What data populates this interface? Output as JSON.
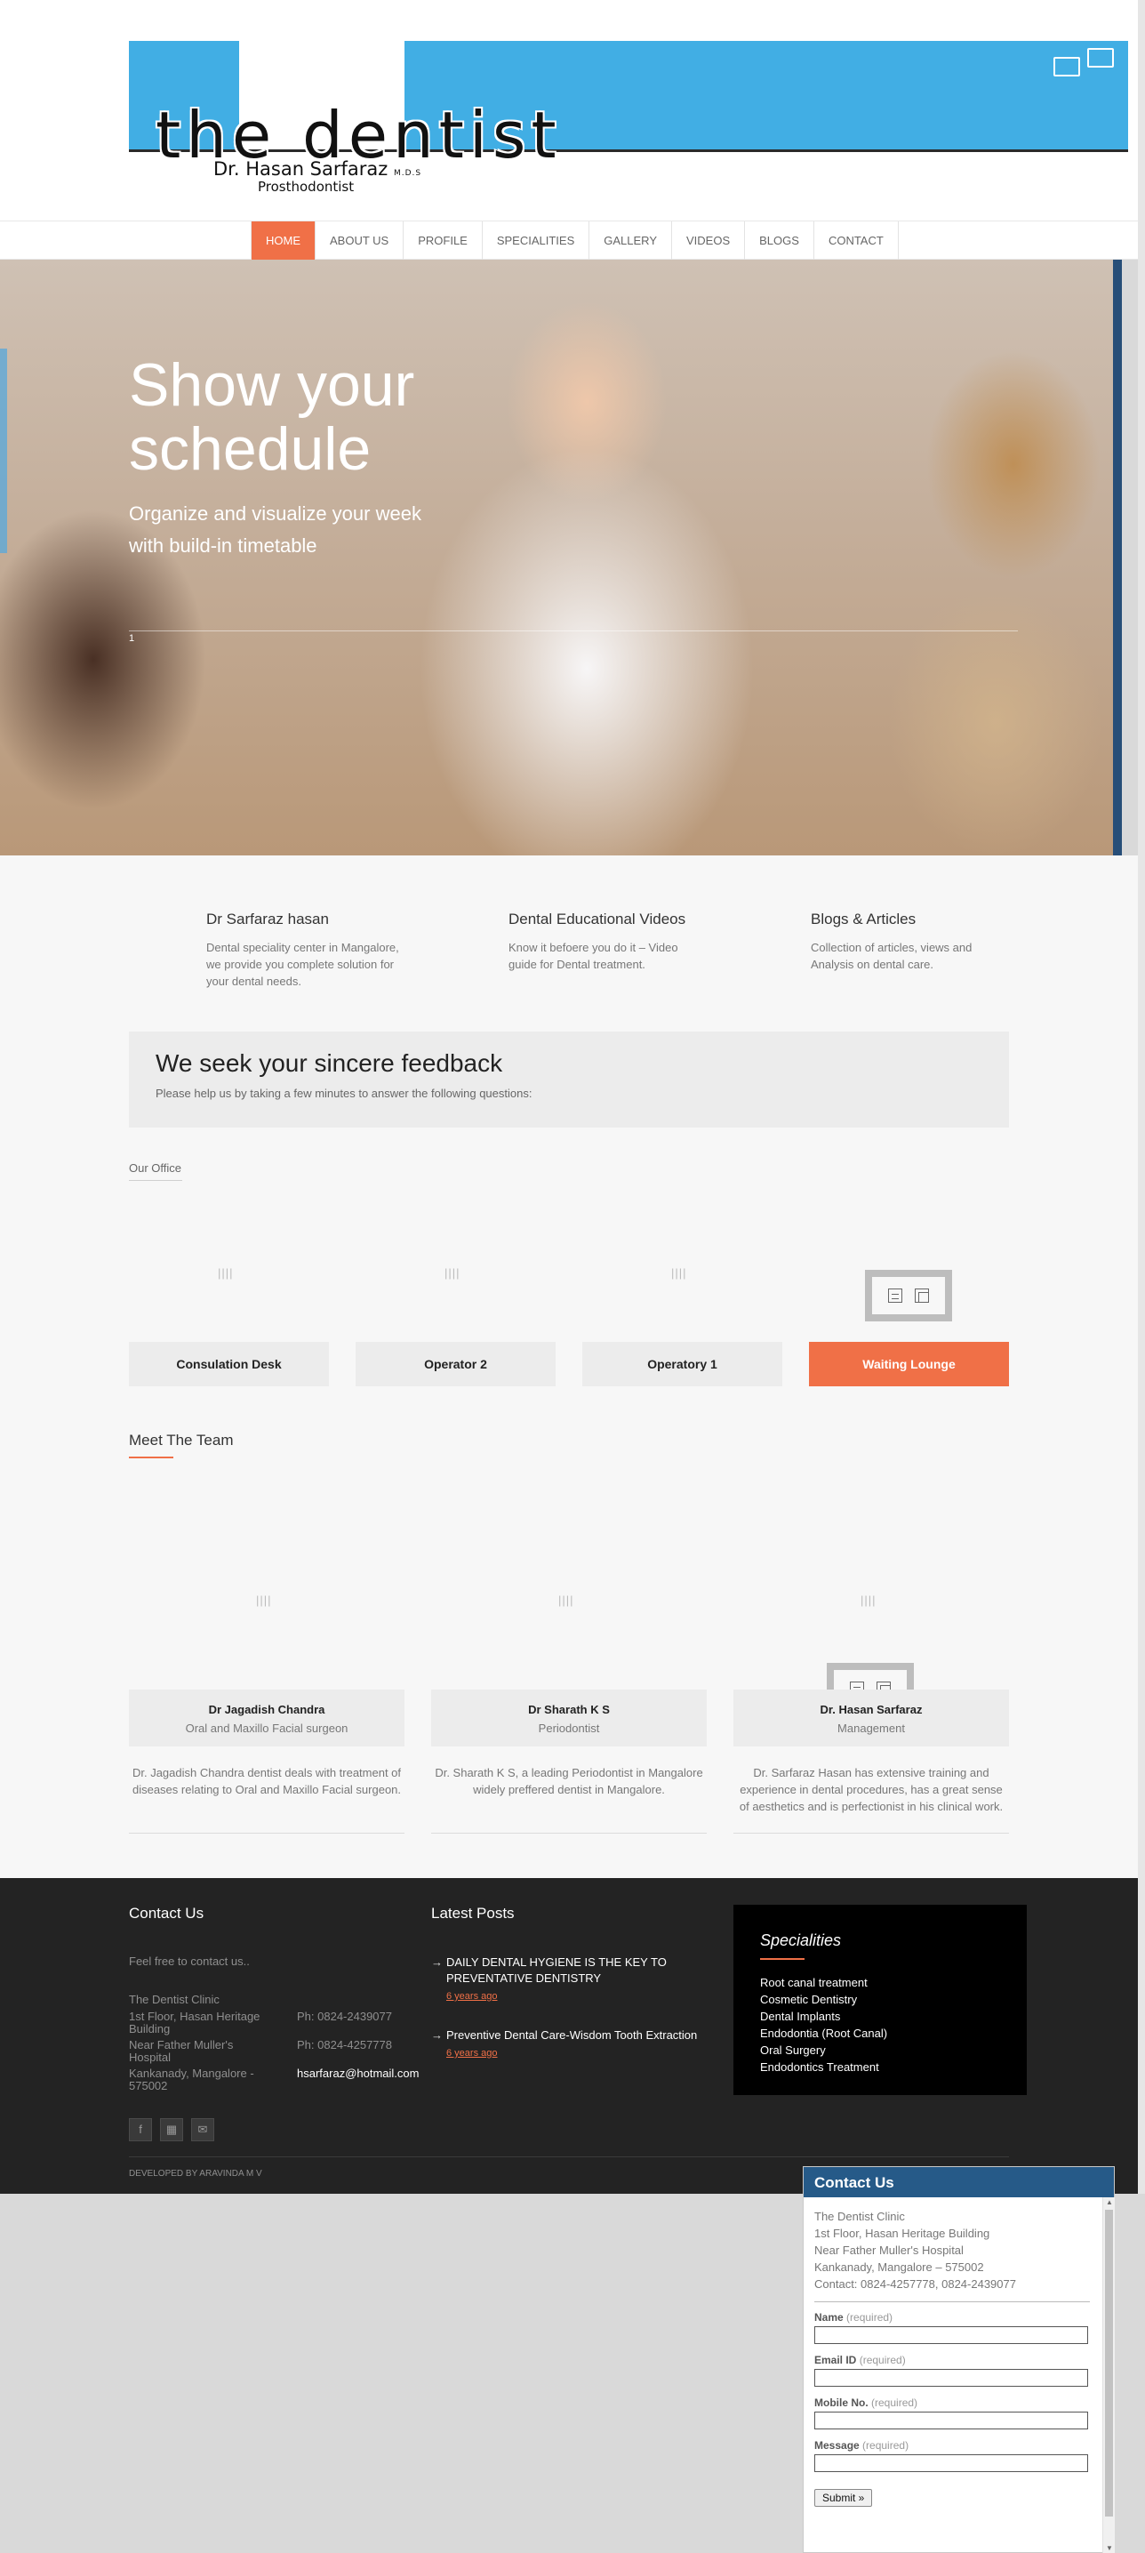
{
  "header": {
    "logo_title": "the dentist",
    "logo_doctor": "Dr. Hasan Sarfaraz",
    "logo_degree": "M.D.S",
    "logo_subtitle": "Prosthodontist",
    "brand_color": "#41aee4"
  },
  "nav": {
    "items": [
      "HOME",
      "ABOUT US",
      "PROFILE",
      "SPECIALITIES",
      "GALLERY",
      "VIDEOS",
      "BLOGS",
      "CONTACT"
    ],
    "active": "HOME",
    "accent_color": "#f07047"
  },
  "hero": {
    "title": "Show your schedule",
    "subtitle": "Organize and visualize your week with build-in timetable",
    "slide_number": "1"
  },
  "features": [
    {
      "title": "Dr Sarfaraz hasan",
      "text": "Dental speciality center in Mangalore, we provide you complete solution for your dental needs."
    },
    {
      "title": "Dental Educational Videos",
      "text": "Know it befoere you do it – Video guide for Dental treatment."
    },
    {
      "title": "Blogs & Articles",
      "text": "Collection of articles, views and Analysis on dental care."
    }
  ],
  "feedback": {
    "title": "We seek your sincere feedback",
    "text": "Please help us by taking a few minutes to answer the following questions:"
  },
  "office": {
    "label": "Our Office",
    "loader": "||||",
    "rooms": [
      "Consulation Desk",
      "Operator 2",
      "Operatory 1",
      "Waiting Lounge"
    ],
    "active_room": "Waiting Lounge"
  },
  "team": {
    "title": "Meet The Team",
    "members": [
      {
        "name": "Dr Jagadish Chandra",
        "role": "Oral and Maxillo Facial surgeon",
        "desc": "Dr. Jagadish Chandra dentist deals with treatment of diseases relating to Oral and Maxillo Facial surgeon."
      },
      {
        "name": "Dr Sharath K S",
        "role": "Periodontist",
        "desc": "Dr. Sharath K S, a leading Periodontist in Mangalore widely preffered dentist in Mangalore."
      },
      {
        "name": "Dr. Hasan Sarfaraz",
        "role": "Management",
        "desc": "Dr. Sarfaraz Hasan has extensive training and experience in dental procedures, has a great sense of aesthetics and is perfectionist in his clinical work."
      }
    ]
  },
  "footer": {
    "contact_title": "Contact Us",
    "contact_intro": "Feel free to contact us..",
    "clinic_name": "The Dentist Clinic",
    "address_1": "1st Floor, Hasan Heritage Building",
    "address_2": "Near Father Muller's Hospital",
    "address_3": "Kankanady, Mangalore - 575002",
    "phone_1": "Ph: 0824-2439077",
    "phone_2": "Ph: 0824-4257778",
    "email": "hsarfaraz@hotmail.com",
    "posts_title": "Latest Posts",
    "posts": [
      {
        "title": "DAILY DENTAL HYGIENE IS THE KEY TO PREVENTATIVE DENTISTRY",
        "ago": "6 years ago"
      },
      {
        "title": "Preventive Dental Care-Wisdom Tooth Extraction",
        "ago": "6 years ago"
      }
    ],
    "specialities_title": "Specialities",
    "specialities": [
      "Root canal treatment",
      "Cosmetic Dentistry",
      "Dental Implants",
      "Endodontia (Root Canal)",
      "Oral Surgery",
      "Endodontics Treatment"
    ],
    "developed_by": "DEVELOPED BY ARAVINDA M V"
  },
  "popup": {
    "title": "Contact Us",
    "address": [
      "The Dentist Clinic",
      "1st Floor, Hasan Heritage Building",
      "Near Father Muller's Hospital",
      "Kankanady, Mangalore – 575002",
      "Contact: 0824-4257778, 0824-2439077"
    ],
    "fields": [
      {
        "label": "Name",
        "hint": "(required)"
      },
      {
        "label": "Email ID",
        "hint": "(required)"
      },
      {
        "label": "Mobile No.",
        "hint": "(required)"
      },
      {
        "label": "Message",
        "hint": "(required)"
      }
    ],
    "submit_label": "Submit »",
    "header_color": "#265a88"
  }
}
